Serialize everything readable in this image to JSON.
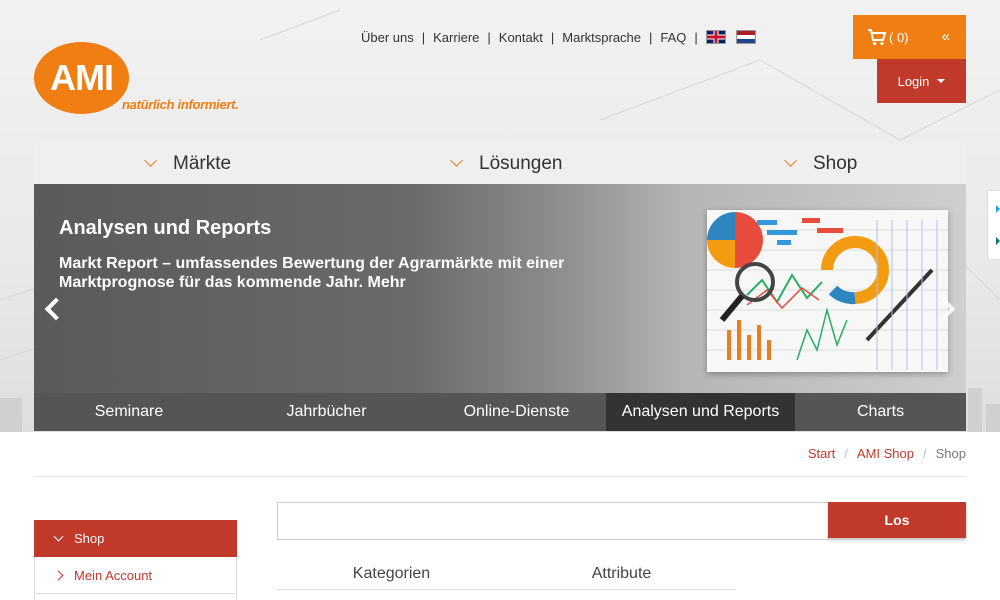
{
  "logo": {
    "text": "AMI",
    "tagline": "natürlich informiert."
  },
  "toplinks": [
    "Über uns",
    "Karriere",
    "Kontakt",
    "Marktsprache",
    "FAQ"
  ],
  "toplink_separator": "|",
  "languages": [
    {
      "icon": "flag-uk-icon"
    },
    {
      "icon": "flag-nl-icon"
    }
  ],
  "cart": {
    "count": "( 0)",
    "collapse_label": "«",
    "icon": "shopping-cart-icon"
  },
  "login": {
    "label": "Login"
  },
  "mainnav": [
    {
      "label": "Märkte"
    },
    {
      "label": "Lösungen"
    },
    {
      "label": "Shop"
    }
  ],
  "slider": {
    "title": "Analysen und Reports",
    "text": "Markt Report – umfassendes Bewertung der Agrarmärkte mit einer Marktprognose für das kommende Jahr. Mehr"
  },
  "subtabs": [
    {
      "label": "Seminare",
      "active": false
    },
    {
      "label": "Jahrbücher",
      "active": false
    },
    {
      "label": "Online-Dienste",
      "active": false
    },
    {
      "label": "Analysen und Reports",
      "active": true
    },
    {
      "label": "Charts",
      "active": false
    }
  ],
  "breadcrumb": {
    "items": [
      "Start",
      "AMI Shop"
    ],
    "current": "Shop",
    "separator": "/"
  },
  "sidemenu": [
    {
      "label": "Shop",
      "active": true
    },
    {
      "label": "Mein Account",
      "active": false
    }
  ],
  "search": {
    "value": "",
    "button": "Los"
  },
  "filtertabs": [
    "Kategorien",
    "Attribute"
  ],
  "colors": {
    "orange": "#f07e13",
    "red": "#c0392b",
    "dark": "#555555"
  }
}
